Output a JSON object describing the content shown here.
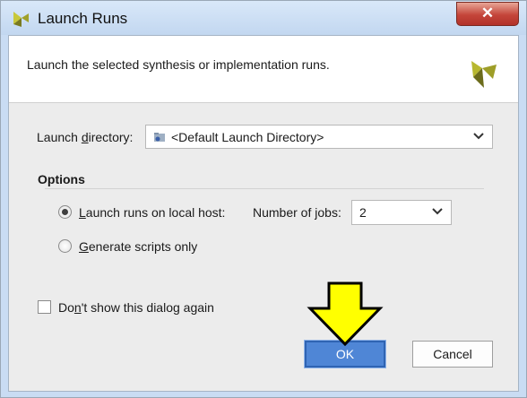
{
  "window": {
    "title": "Launch Runs",
    "close_label": "✕"
  },
  "header": {
    "description": "Launch the selected synthesis or implementation runs."
  },
  "launch_directory": {
    "label_before": "Launch ",
    "label_mnemonic": "d",
    "label_after": "irectory:",
    "value": "<Default Launch Directory>"
  },
  "options": {
    "heading": "Options",
    "local_host": {
      "label_before": "",
      "label_mnemonic": "L",
      "label_after": "aunch runs on local host:",
      "selected": true
    },
    "jobs": {
      "label_before": "Number of ",
      "label_mnemonic": "j",
      "label_after": "obs:",
      "value": "2"
    },
    "scripts_only": {
      "label_before": "",
      "label_mnemonic": "G",
      "label_after": "enerate scripts only",
      "selected": false
    }
  },
  "dont_show": {
    "label_before": "Do",
    "label_mnemonic": "n",
    "label_after": "'t show this dialog again",
    "checked": false
  },
  "buttons": {
    "ok": "OK",
    "cancel": "Cancel"
  },
  "colors": {
    "accent": "#4f86d6",
    "arrow": "#ffff00"
  }
}
